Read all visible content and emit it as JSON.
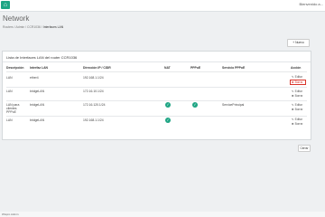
{
  "topbar": {
    "home_icon": "home-icon",
    "user_menu": "Bienvenido a..."
  },
  "page": {
    "title": "Network"
  },
  "breadcrumb": {
    "items": [
      "Routers",
      "Admin",
      "CCR1036"
    ],
    "current": "Interfaces LAN",
    "separator": "/"
  },
  "new_button": {
    "icon": "plus-icon",
    "label": "Nuevo"
  },
  "panel": {
    "title": "Lista de Interfaces LAN del router CCR1036"
  },
  "table": {
    "headers": [
      "Descripción",
      "Interfaz LAN",
      "Dirección IP / CIDR",
      "NAT",
      "PPPoE",
      "Servicio PPPoE",
      "Acción"
    ],
    "rows": [
      {
        "desc": "LAN",
        "iface": "ether4",
        "ip": "192.168.1.1/24",
        "nat": "",
        "pppoe": "",
        "service": "",
        "edit": "Editar",
        "delete": "Borrar"
      },
      {
        "desc": "LAN",
        "iface": "bridgeLAN",
        "ip": "172.16.10.1/24",
        "nat": "",
        "pppoe": "",
        "service": "",
        "edit": "Editar",
        "delete": "Borrar"
      },
      {
        "desc": "LAN para clientes PPPoE",
        "iface": "bridgeLAN",
        "ip": "172.16.120.1/24",
        "nat": "✓",
        "pppoe": "✓",
        "service": "ServicePrincipal",
        "edit": "Editar",
        "delete": "Borrar"
      },
      {
        "desc": "LAN",
        "iface": "bridgeLAN",
        "ip": "192.168.1.1/24",
        "nat": "✓",
        "pppoe": "",
        "service": "",
        "edit": "Editar",
        "delete": "Borrar"
      }
    ]
  },
  "close_button": {
    "label": "Cerrar"
  },
  "status_bar": {
    "text": "Wispro Admin"
  },
  "colors": {
    "accent": "#1fa584",
    "highlight": "#d9342b"
  }
}
